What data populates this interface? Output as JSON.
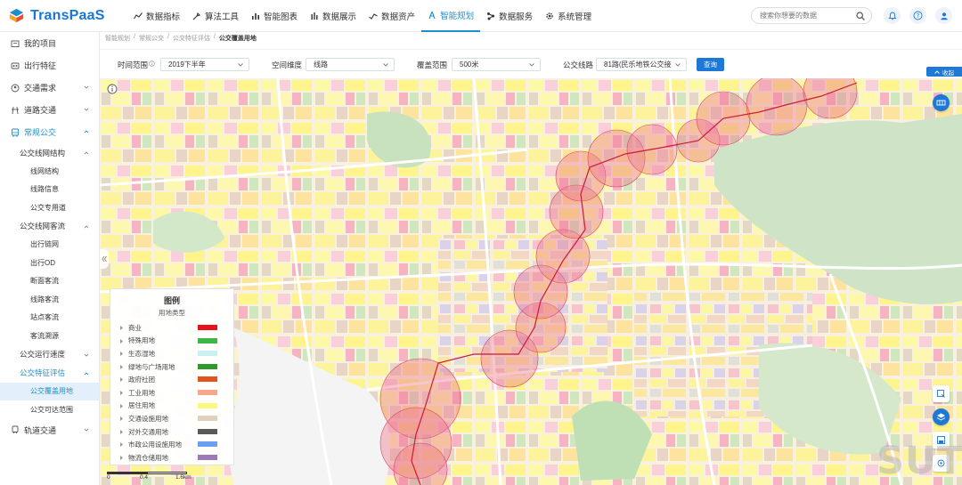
{
  "app": {
    "logo_text": "TransPaaS",
    "brand_color": "#1976d2",
    "accent_color": "#1d8fcc"
  },
  "nav": [
    {
      "label": "数据指标",
      "icon": "chart-line-icon",
      "active": false
    },
    {
      "label": "算法工具",
      "icon": "tools-icon",
      "active": false
    },
    {
      "label": "智能图表",
      "icon": "bar-chart-icon",
      "active": false
    },
    {
      "label": "数据展示",
      "icon": "column-chart-icon",
      "active": false
    },
    {
      "label": "数据资产",
      "icon": "trend-icon",
      "active": false
    },
    {
      "label": "智能规划",
      "icon": "planning-icon",
      "active": true
    },
    {
      "label": "数据服务",
      "icon": "nodes-icon",
      "active": false
    },
    {
      "label": "系统管理",
      "icon": "gear-icon",
      "active": false
    }
  ],
  "search": {
    "placeholder": "搜索你想要的数据"
  },
  "sidebar": {
    "my_projects": "我的项目",
    "travel_features": "出行特征",
    "traffic_demand": "交通需求",
    "road_traffic": "道路交通",
    "regular_bus": "常规公交",
    "bus_network": "公交线网结构",
    "network_structure": "线网结构",
    "line_info": "线路信息",
    "bus_lane": "公交专用道",
    "bus_flow": "公交线网客流",
    "travel_chain": "出行链网",
    "travel_od": "出行OD",
    "section_flow": "断面客流",
    "line_flow": "线路客流",
    "stop_flow": "站点客流",
    "flow_source": "客流溯源",
    "bus_speed": "公交运行速度",
    "bus_eval": "公交特征评估",
    "coverage_land": "公交覆盖用地",
    "reachable_range": "公交可达范围",
    "rail_transit": "轨道交通"
  },
  "breadcrumb": [
    "智能规划",
    "常规公交",
    "公交特征评估",
    "公交覆盖用地"
  ],
  "filters": {
    "time_label": "时间范围",
    "time_value": "2019下半年",
    "dimension_label": "空间维度",
    "dimension_value": "线路",
    "coverage_label": "覆盖范围",
    "coverage_value": "500米",
    "line_label": "公交线路",
    "line_value": "81路(民乐地铁公交接",
    "query_button": "查询",
    "collapse_button": "收起"
  },
  "legend": {
    "title": "图例",
    "subtitle": "用地类型",
    "items": [
      {
        "label": "商业",
        "color": "#e8111c"
      },
      {
        "label": "特殊用地",
        "color": "#3fb54a"
      },
      {
        "label": "生态湿地",
        "color": "#c9f1ef"
      },
      {
        "label": "绿地与广场用地",
        "color": "#2f9a2b"
      },
      {
        "label": "政府社团",
        "color": "#e2531f"
      },
      {
        "label": "工业用地",
        "color": "#f6a78c"
      },
      {
        "label": "居住用地",
        "color": "#fdf77a"
      },
      {
        "label": "交通设施用地",
        "color": "#dfd2bc"
      },
      {
        "label": "对外交通用地",
        "color": "#5a5a5a"
      },
      {
        "label": "市政公用设施用地",
        "color": "#6d9ff1"
      },
      {
        "label": "物流仓储用地",
        "color": "#9c7bb5"
      }
    ]
  },
  "scale": {
    "labels": [
      "0",
      "0.4",
      "1.6km"
    ]
  },
  "watermark": "SUTPC"
}
